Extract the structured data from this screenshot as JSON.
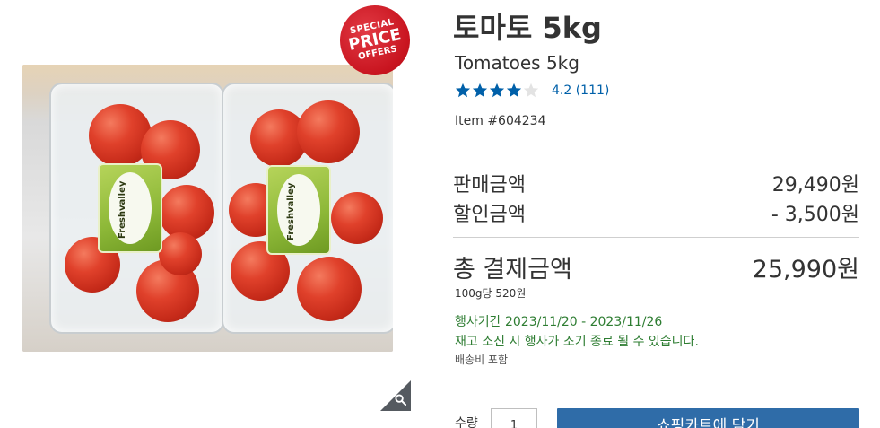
{
  "badge": {
    "line1": "SPECIAL",
    "line2": "PRICE",
    "line3": "OFFERS",
    "color": "#c8141f"
  },
  "product_image": {
    "label_brand": "Freshvalley",
    "zoom_icon": "magnifier-icon"
  },
  "product": {
    "title_ko": "토마토 5kg",
    "title_en": "Tomatoes 5kg",
    "rating": 4.2,
    "rating_label": "4.2",
    "review_count": "(111)",
    "item_number": "Item #604234",
    "star_color": "#0060a9"
  },
  "pricing": {
    "sale_price_label": "판매금액",
    "sale_price": "29,490원",
    "discount_label": "할인금액",
    "discount": "- 3,500원",
    "total_label": "총 결제금액",
    "total": "25,990원",
    "unit_price": "100g당 520원"
  },
  "promotion": {
    "period": "행사기간 2023/11/20 - 2023/11/26",
    "notice": "재고 소진 시 행사가 조기 종료 될 수 있습니다.",
    "shipping": "배송비 포함",
    "text_color": "#2e7d32"
  },
  "purchase": {
    "quantity_label": "수량",
    "quantity": "1",
    "add_to_cart_label": "쇼핑카트에 담기",
    "button_color": "#2f6ca8"
  }
}
